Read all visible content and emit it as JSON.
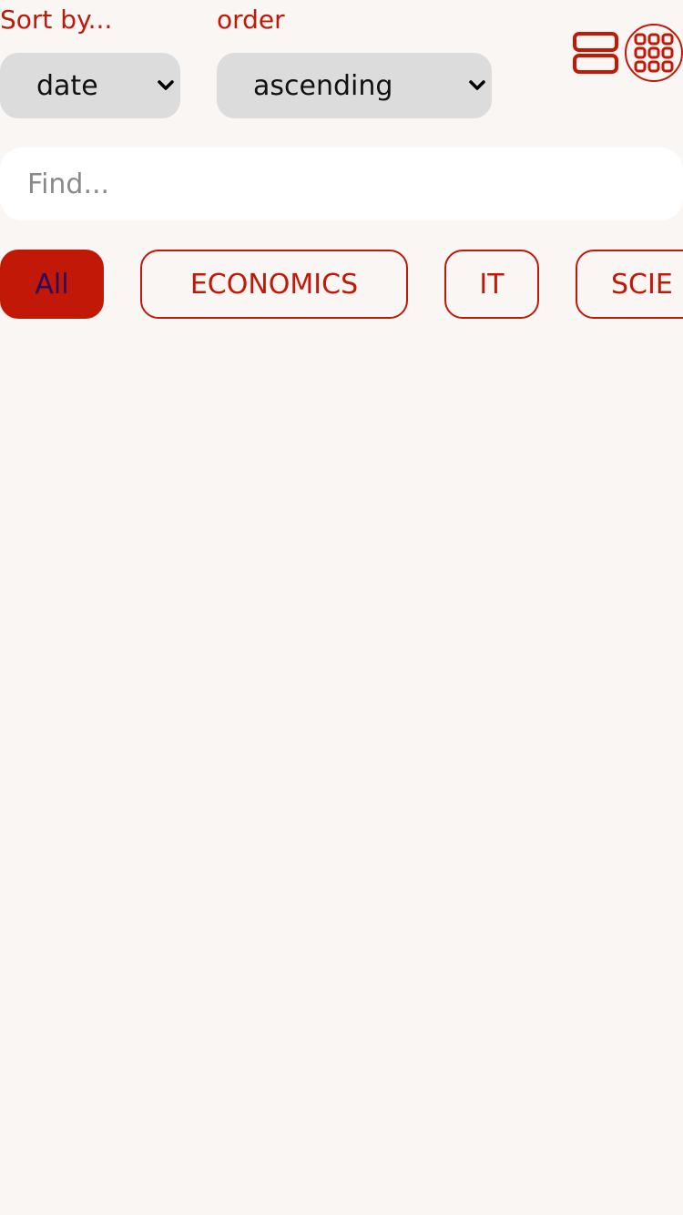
{
  "sort": {
    "label": "Sort by...",
    "selected": "date"
  },
  "order": {
    "label": "order",
    "selected": "ascending"
  },
  "view_toggle": {
    "options": [
      "list-view-icon",
      "grid-view-icon"
    ]
  },
  "search": {
    "placeholder": "Find..."
  },
  "categories": [
    {
      "label": "All",
      "active": true
    },
    {
      "label": "ECONOMICS",
      "active": false
    },
    {
      "label": "IT",
      "active": false
    },
    {
      "label": "SCIE",
      "active": false
    }
  ],
  "colors": {
    "accent": "#c21807",
    "background": "#faf6f3",
    "select_bg": "#dcdcdc",
    "active_chip_text": "#2b0a5c"
  }
}
